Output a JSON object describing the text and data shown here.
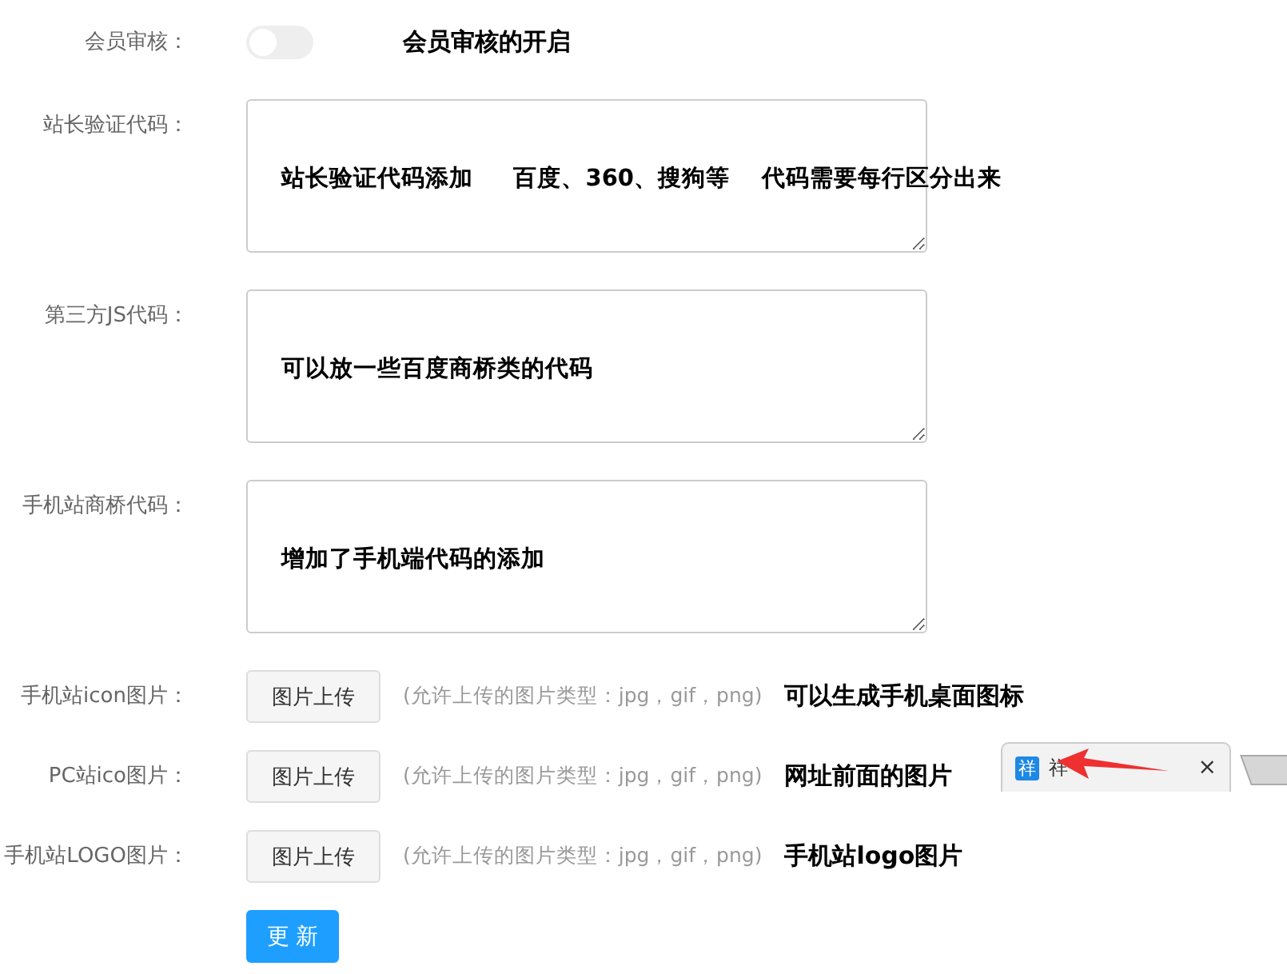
{
  "fields": [
    {
      "kind": "switch",
      "label": "会员审核：",
      "on": false,
      "note": "会员审核的开启"
    },
    {
      "kind": "code",
      "label": "站长验证代码：",
      "value": "站长验证代码添加     百度、360、搜狗等    代码需要每行区分出来"
    },
    {
      "kind": "code",
      "label": "第三方JS代码：",
      "value": "可以放一些百度商桥类的代码"
    },
    {
      "kind": "code",
      "label": "手机站商桥代码：",
      "value": "增加了手机端代码的添加"
    },
    {
      "kind": "upload",
      "label": "手机站icon图片：",
      "button": "图片上传",
      "hint": "(允许上传的图片类型：jpg，gif，png)",
      "note": "可以生成手机桌面图标"
    },
    {
      "kind": "upload",
      "label": "PC站ico图片：",
      "button": "图片上传",
      "hint": "(允许上传的图片类型：jpg，gif，png)",
      "note": "网址前面的图片"
    },
    {
      "kind": "upload",
      "label": "手机站LOGO图片：",
      "button": "图片上传",
      "hint": "(允许上传的图片类型：jpg，gif，png)",
      "note": "手机站logo图片"
    }
  ],
  "submit": "更 新",
  "browser_tab": {
    "icon": "祥",
    "title": "祥",
    "close": "×"
  }
}
